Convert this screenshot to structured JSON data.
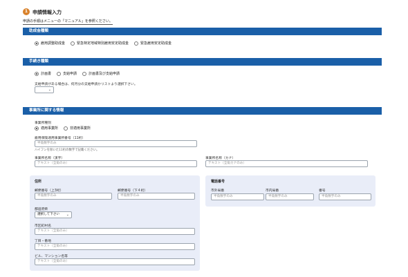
{
  "header": {
    "step": "1",
    "title": "申請情報入力",
    "manual_note": "申請の手順はメニューの「マニュアル」を参照ください。"
  },
  "subsidy_type": {
    "heading": "助成金種類",
    "options": [
      "雇用調整助成金",
      "緊急特定地域特別雇用安定助成金",
      "緊急雇用安定助成金"
    ],
    "selected": 0
  },
  "procedure": {
    "heading": "手続き種類",
    "options": [
      "計画書",
      "支給申請",
      "計画書及び支給申請"
    ],
    "selected": 0,
    "note": "支給申請がある場合は、何月分の支給申請かリストより選択下さい。",
    "month_value": ""
  },
  "business": {
    "heading": "事業所に関する情報",
    "type_label": "事業所種別",
    "type_options": [
      "適用事業所",
      "非適用事業所"
    ],
    "type_selected": 0,
    "insurance_label": "雇用保険適用事業所番号（11桁）",
    "insurance_placeholder": "半角数字のみ",
    "insurance_hint": "ハイフンを除いた11桁の数字で記載ください。",
    "name_kanji_label": "事業所名称（漢字）",
    "name_kanji_placeholder": "テキスト（全角のみ）",
    "name_kana_label": "事業所名称（カナ）",
    "name_kana_placeholder": "テキスト（全角カナのみ）"
  },
  "address": {
    "heading": "住所",
    "postal_upper_label": "郵便番号（上3桁）",
    "postal_upper_placeholder": "半角数字のみ",
    "postal_lower_label": "郵便番号（下４桁）",
    "postal_lower_placeholder": "半角数字のみ",
    "prefecture_label": "都道府県",
    "prefecture_value": "選択して下さい",
    "city_label": "市区町村名",
    "city_placeholder": "テキスト（全角のみ）",
    "block_label": "丁目・番地",
    "block_placeholder": "テキスト（全角のみ）",
    "building_label": "ビル、マンション名等",
    "building_placeholder": "テキスト（全角のみ）"
  },
  "phone": {
    "heading": "電話番号",
    "area_label": "市外局番",
    "area_placeholder": "半角数字のみ",
    "local_label": "市内局番",
    "local_placeholder": "半角数字のみ",
    "number_label": "番号",
    "number_placeholder": "半角数字のみ"
  }
}
